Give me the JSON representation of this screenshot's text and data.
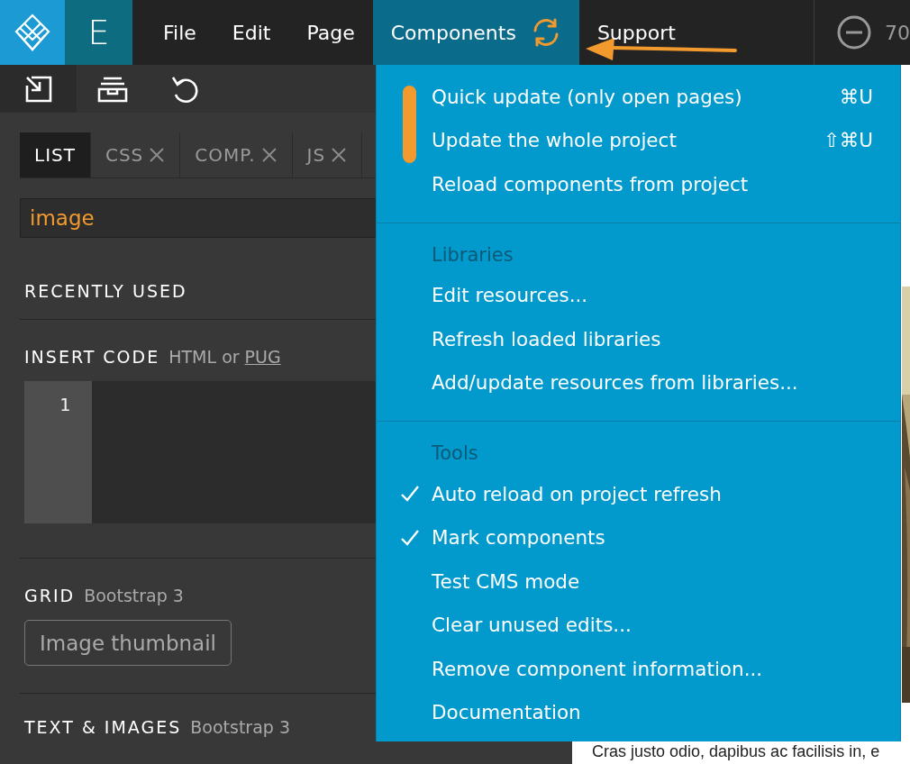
{
  "menubar": {
    "mode_mark": "E",
    "items": [
      {
        "label": "File",
        "selected": false
      },
      {
        "label": "Edit",
        "selected": false
      },
      {
        "label": "Page",
        "selected": false
      },
      {
        "label": "Components",
        "selected": true,
        "kind": "sync"
      },
      {
        "label": "Support",
        "selected": false
      }
    ],
    "zoom": "70"
  },
  "tabs": [
    {
      "label": "LIST",
      "selected": true,
      "closable": false
    },
    {
      "label": "CSS",
      "selected": false,
      "closable": true
    },
    {
      "label": "COMP.",
      "selected": false,
      "closable": true
    },
    {
      "label": "JS",
      "selected": false,
      "closable": true
    }
  ],
  "search": {
    "value": "image"
  },
  "sections": {
    "recently_used": "RECENTLY USED",
    "insert_code": {
      "title": "INSERT CODE",
      "hint": "HTML or",
      "link": "PUG",
      "line_numbers": [
        "1"
      ]
    },
    "grid": {
      "title": "GRID",
      "subtitle": "Bootstrap 3",
      "buttons": [
        "Image thumbnail"
      ]
    },
    "text_images": {
      "title": "TEXT & IMAGES",
      "subtitle": "Bootstrap 3"
    }
  },
  "menu": [
    {
      "items": [
        {
          "label": "Quick update (only open pages)",
          "shortcut": "⌘U",
          "checked": false
        },
        {
          "label": "Update the whole project",
          "shortcut": "⇧⌘U",
          "checked": false
        },
        {
          "label": "Reload components from project",
          "checked": false
        }
      ]
    },
    {
      "header": "Libraries",
      "items": [
        {
          "label": "Edit resources...",
          "checked": false
        },
        {
          "label": "Refresh loaded libraries",
          "checked": false
        },
        {
          "label": "Add/update resources from libraries...",
          "checked": false
        }
      ]
    },
    {
      "header": "Tools",
      "items": [
        {
          "label": "Auto reload on project refresh",
          "checked": true
        },
        {
          "label": "Mark components",
          "checked": true
        },
        {
          "label": "Test CMS mode",
          "checked": false
        },
        {
          "label": "Clear unused edits...",
          "checked": false
        },
        {
          "label": "Remove component information...",
          "checked": false
        },
        {
          "label": "Documentation",
          "checked": false
        }
      ]
    }
  ],
  "page_text": "Cras justo odio, dapibus ac facilisis in, e"
}
